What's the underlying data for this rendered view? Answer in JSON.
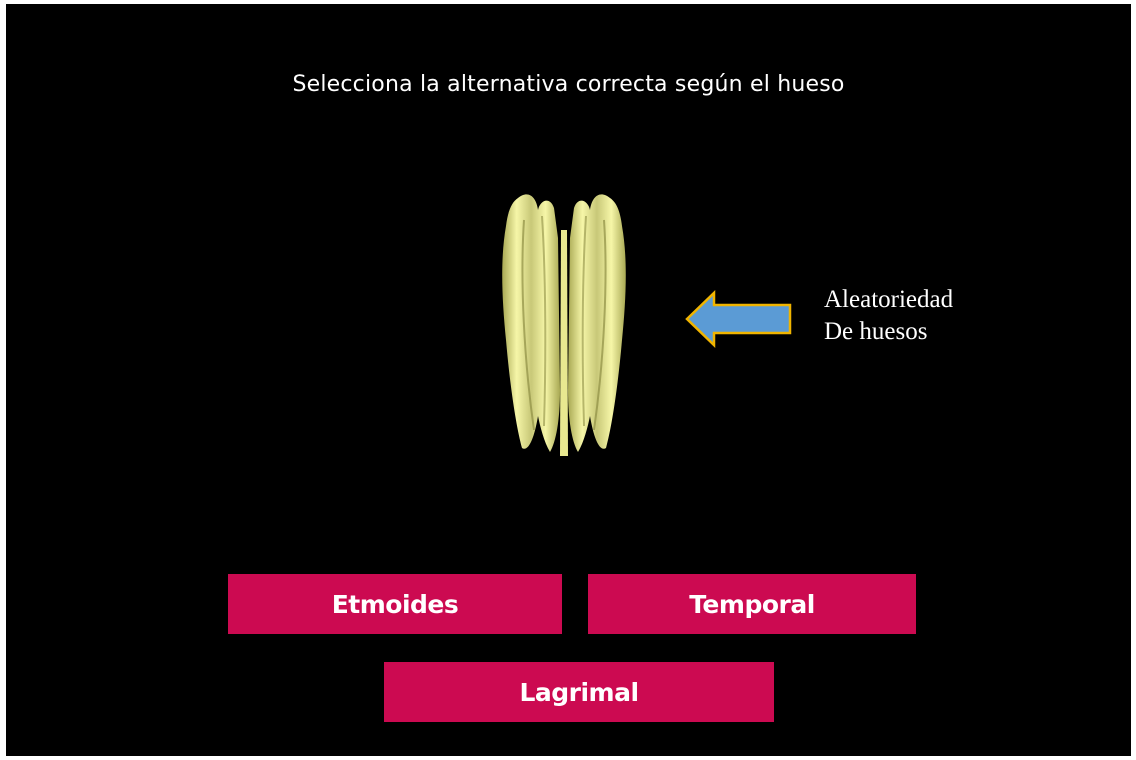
{
  "quiz": {
    "title": "Selecciona la alternativa correcta según el hueso",
    "bone_icon": "bone-3d-model-icon",
    "options": [
      {
        "label": "Etmoides"
      },
      {
        "label": "Temporal"
      },
      {
        "label": "Lagrimal"
      }
    ]
  },
  "annotation": {
    "arrow_icon": "left-arrow-icon",
    "line1": "Aleatoriedad",
    "line2": "De huesos"
  },
  "colors": {
    "background": "#000000",
    "button": "#cc0a51",
    "bone": "#f3f3a0",
    "arrow_fill": "#5b9bd5",
    "arrow_stroke": "#f0b400"
  }
}
